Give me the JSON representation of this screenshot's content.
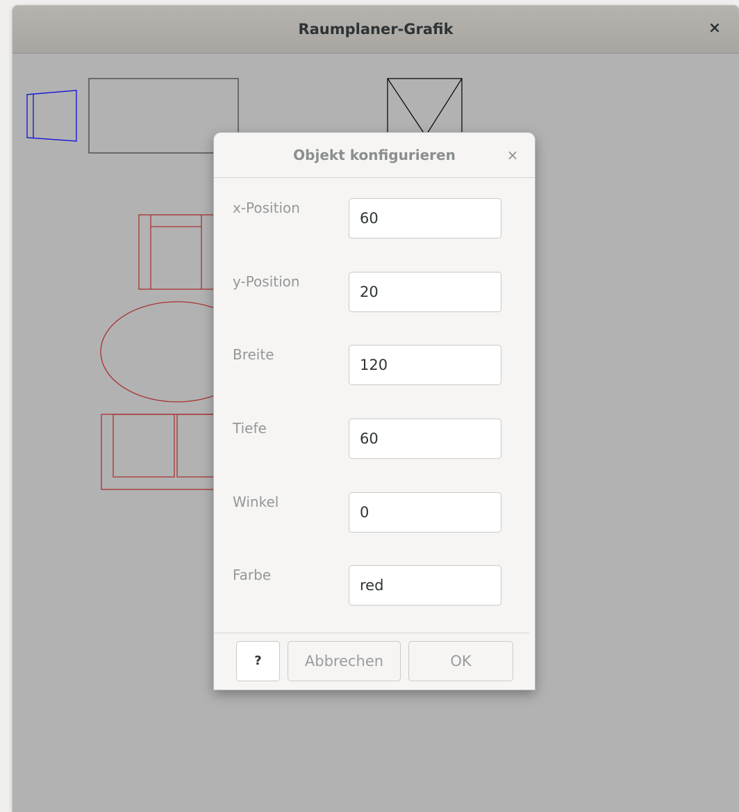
{
  "window": {
    "title": "Raumplaner-Grafik",
    "close_symbol": "×"
  },
  "dialog": {
    "title": "Objekt konfigurieren",
    "close_symbol": "×",
    "fields": [
      {
        "label": "x-Position",
        "value": "60"
      },
      {
        "label": "y-Position",
        "value": "20"
      },
      {
        "label": "Breite",
        "value": "120"
      },
      {
        "label": "Tiefe",
        "value": "60"
      },
      {
        "label": "Winkel",
        "value": "0"
      },
      {
        "label": "Farbe",
        "value": "red"
      }
    ],
    "buttons": {
      "help": "?",
      "cancel": "Abbrechen",
      "ok": "OK"
    }
  },
  "canvas": {
    "background_color": "#b2b2b2",
    "objects": [
      {
        "name": "blue-door",
        "color": "#1a1ad6"
      },
      {
        "name": "table",
        "color": "#2e2e2e"
      },
      {
        "name": "wardrobe",
        "color": "#000000"
      },
      {
        "name": "armchair",
        "color": "#a83232"
      },
      {
        "name": "oval-table",
        "color": "#a83232"
      },
      {
        "name": "sofa",
        "color": "#a83232"
      }
    ]
  }
}
